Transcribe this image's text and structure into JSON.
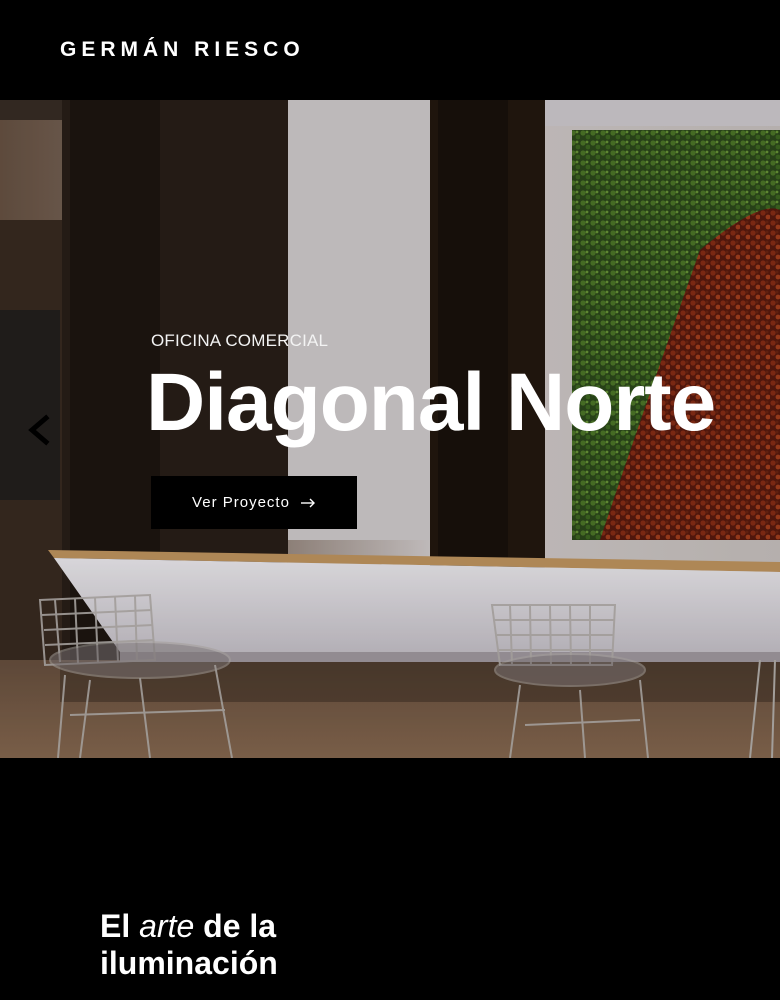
{
  "header": {
    "brand": "GERMÁN RIESCO"
  },
  "hero": {
    "eyebrow": "OFICINA COMERCIAL",
    "title": "Diagonal Norte",
    "cta_label": "Ver Proyecto",
    "cta_icon": "arrow-right-icon",
    "prev_icon": "chevron-left-icon"
  },
  "intro": {
    "heading_part1": "El",
    "heading_italic": "arte",
    "heading_part2": "de la",
    "heading_line2": "iluminación"
  },
  "colors": {
    "background": "#000000",
    "text": "#ffffff",
    "button_bg": "#000000"
  }
}
